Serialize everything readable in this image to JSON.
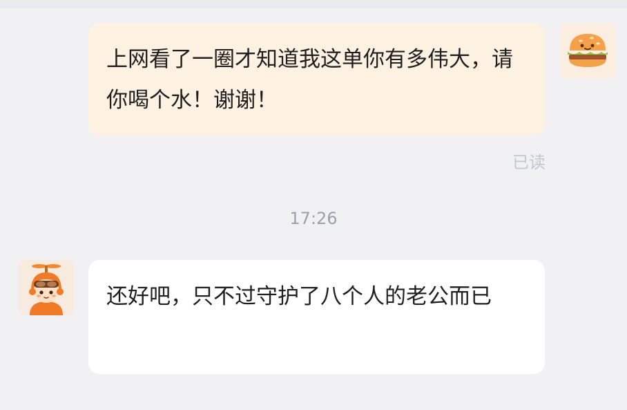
{
  "messages": [
    {
      "direction": "outgoing",
      "text": "上网看了一圈才知道我这单你有多伟大，请你喝个水！谢谢！",
      "status": "已读",
      "avatar_icon": "burger-avatar-icon"
    },
    {
      "direction": "incoming",
      "text": "还好吧，只不过守护了八个人的老公而已",
      "avatar_icon": "rider-avatar-icon"
    }
  ],
  "timestamp": "17:26",
  "colors": {
    "background": "#f1f1f3",
    "outgoing_bubble": "#fdf1e1",
    "incoming_bubble": "#ffffff",
    "meta_text": "#9aa0a9"
  }
}
